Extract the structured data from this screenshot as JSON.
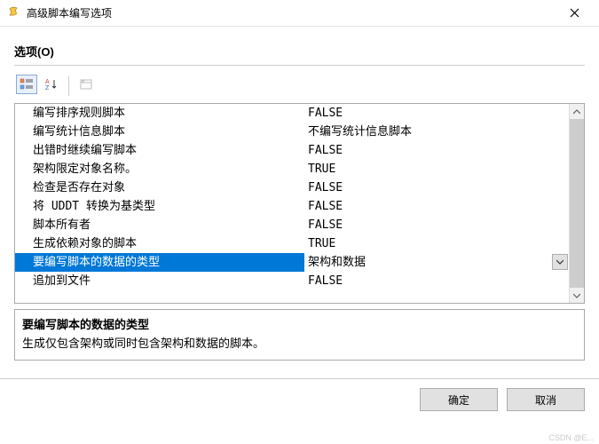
{
  "window": {
    "title": "高级脚本编写选项"
  },
  "section": {
    "label": "选项(O)"
  },
  "grid": {
    "rows": [
      {
        "label": "编写排序规则脚本",
        "value": "FALSE",
        "selected": false
      },
      {
        "label": "编写统计信息脚本",
        "value": "不编写统计信息脚本",
        "selected": false
      },
      {
        "label": "出错时继续编写脚本",
        "value": "FALSE",
        "selected": false
      },
      {
        "label": "架构限定对象名称。",
        "value": "TRUE",
        "selected": false
      },
      {
        "label": "检查是否存在对象",
        "value": "FALSE",
        "selected": false
      },
      {
        "label": "将 UDDT 转换为基类型",
        "value": "FALSE",
        "selected": false
      },
      {
        "label": "脚本所有者",
        "value": "FALSE",
        "selected": false
      },
      {
        "label": "生成依赖对象的脚本",
        "value": "TRUE",
        "selected": false
      },
      {
        "label": "要编写脚本的数据的类型",
        "value": "架构和数据",
        "selected": true
      },
      {
        "label": "追加到文件",
        "value": "FALSE",
        "selected": false
      }
    ]
  },
  "description": {
    "title": "要编写脚本的数据的类型",
    "text": "生成仅包含架构或同时包含架构和数据的脚本。"
  },
  "buttons": {
    "ok": "确定",
    "cancel": "取消"
  },
  "watermark": "CSDN @E..."
}
